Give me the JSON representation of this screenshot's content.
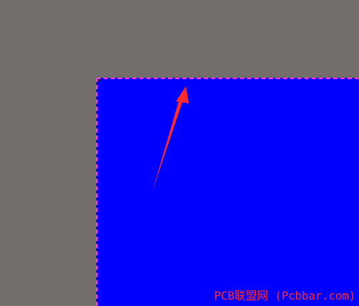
{
  "watermark": {
    "text": "PCB联盟网 (Pcbbar.com)"
  },
  "colors": {
    "background": "#736e6b",
    "board_fill": "#0000ff",
    "board_outline": "#ff33ff",
    "arrow": "#ff2a2a",
    "watermark": "#ff2a2a"
  },
  "icons": {
    "arrow": "red-arrow-icon"
  }
}
